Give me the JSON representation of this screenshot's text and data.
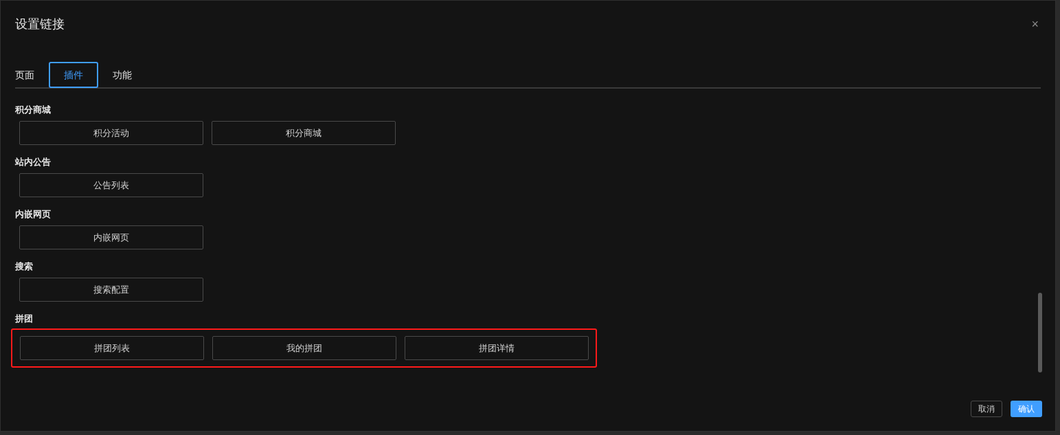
{
  "dialog": {
    "title": "设置链接",
    "close": "×"
  },
  "tabs": [
    {
      "label": "页面",
      "selected": false
    },
    {
      "label": "插件",
      "selected": true
    },
    {
      "label": "功能",
      "selected": false
    }
  ],
  "groups": [
    {
      "title": "积分商城",
      "highlighted": false,
      "items": [
        "积分活动",
        "积分商城"
      ]
    },
    {
      "title": "站内公告",
      "highlighted": false,
      "items": [
        "公告列表"
      ]
    },
    {
      "title": "内嵌网页",
      "highlighted": false,
      "items": [
        "内嵌网页"
      ]
    },
    {
      "title": "搜索",
      "highlighted": false,
      "items": [
        "搜索配置"
      ]
    },
    {
      "title": "拼团",
      "highlighted": true,
      "items": [
        "拼团列表",
        "我的拼团",
        "拼团详情"
      ]
    }
  ],
  "footer": {
    "cancel": "取消",
    "confirm": "确认"
  }
}
